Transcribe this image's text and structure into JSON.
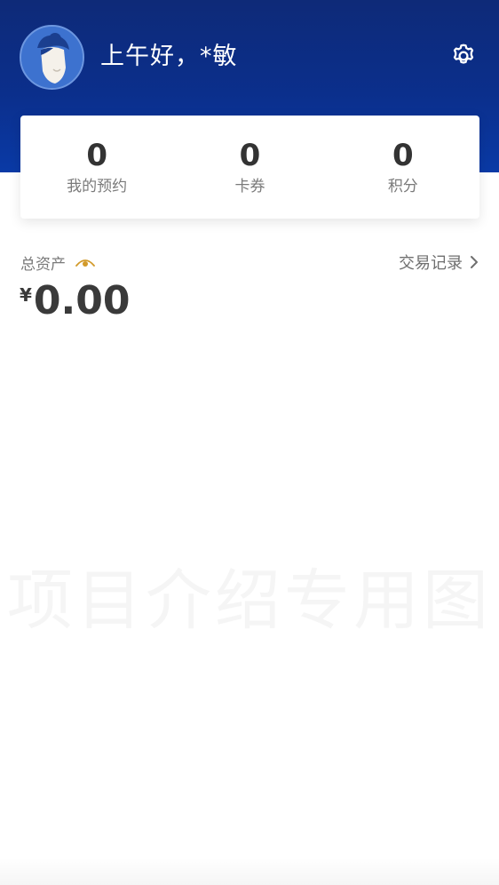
{
  "header": {
    "greeting": "上午好，*敏",
    "avatar_icon": "avatar-icon",
    "settings_icon": "gear-icon"
  },
  "stats": [
    {
      "value": "0",
      "label": "我的预约"
    },
    {
      "value": "0",
      "label": "卡券"
    },
    {
      "value": "0",
      "label": "积分"
    }
  ],
  "assets": {
    "label": "总资产",
    "visibility_icon": "eye-icon",
    "currency": "¥",
    "amount": "0.00",
    "transactions_label": "交易记录",
    "transactions_icon": "chevron-right-icon"
  },
  "watermark": "项目介绍专用图",
  "colors": {
    "header_top": "#0e2a78",
    "header_bottom": "#0a3aa6",
    "eye_accent": "#d29a2a",
    "text_primary": "#333333",
    "text_secondary": "#7a7a7a"
  }
}
